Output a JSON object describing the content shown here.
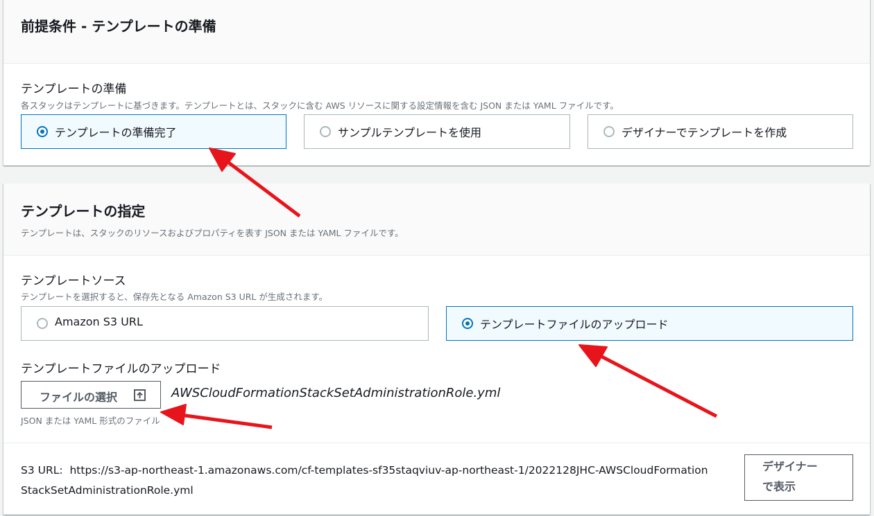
{
  "prereq": {
    "title": "前提条件 - テンプレートの準備",
    "field_label": "テンプレートの準備",
    "field_desc": "各スタックはテンプレートに基づきます。テンプレートとは、スタックに含む AWS リソースに関する設定情報を含む JSON または YAML ファイルです。",
    "options": [
      {
        "label": "テンプレートの準備完了",
        "selected": true
      },
      {
        "label": "サンプルテンプレートを使用",
        "selected": false
      },
      {
        "label": "デザイナーでテンプレートを作成",
        "selected": false
      }
    ]
  },
  "specify": {
    "title": "テンプレートの指定",
    "subtitle": "テンプレートは、スタックのリソースおよびプロパティを表す JSON または YAML ファイルです。",
    "source_label": "テンプレートソース",
    "source_desc": "テンプレートを選択すると、保存先となる Amazon S3 URL が生成されます。",
    "source_options": [
      {
        "label": "Amazon S3 URL",
        "selected": false
      },
      {
        "label": "テンプレートファイルのアップロード",
        "selected": true
      }
    ],
    "upload_label": "テンプレートファイルのアップロード",
    "choose_file_button": "ファイルの選択",
    "file_name": "AWSCloudFormationStackSetAdministrationRole.yml",
    "file_hint": "JSON または YAML 形式のファイル",
    "s3_url_label": "S3 URL:",
    "s3_url_line1": "https://s3-ap-northeast-1.amazonaws.com/cf-templates-sf35staqviuv-ap-northeast-1/2022128JHC-AWSCloudFormation",
    "s3_url_line2": "StackSetAdministrationRole.yml",
    "designer_button_line1": "デザイナー",
    "designer_button_line2": "で表示"
  },
  "colors": {
    "accent": "#0073bb",
    "annotation_arrow": "#e8141b"
  },
  "icons": {
    "upload": "upload-icon",
    "arrow": "annotation-arrow"
  }
}
